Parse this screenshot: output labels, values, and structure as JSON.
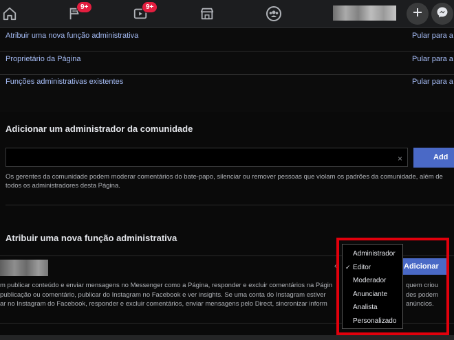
{
  "topbar": {
    "icons": [
      "home-icon",
      "flag-icon",
      "video-icon",
      "marketplace-icon",
      "groups-icon",
      "plus-icon",
      "messenger-icon"
    ],
    "badges": {
      "pages": "9+",
      "watch": "9+"
    }
  },
  "admin_links": [
    {
      "label": "Atribuir uma nova função administrativa",
      "skip": "Pular para a s"
    },
    {
      "label": "Proprietário da Página",
      "skip": "Pular para a s"
    },
    {
      "label": "Funções administrativas existentes",
      "skip": "Pular para a s"
    }
  ],
  "community": {
    "title": "Adicionar um administrador da comunidade",
    "input_value": "",
    "clear": "×",
    "add_label": "Add",
    "help_line1": "Os gerentes da comunidade podem moderar comentários do bate-papo, silenciar ou remover pessoas que violam os padrões da comunidade, além de",
    "help_line2": "todos os administradores desta Página."
  },
  "assign": {
    "title": "Atribuir uma nova função administrativa",
    "add_label": "Adicionar",
    "desc_lines": [
      "m publicar conteúdo e enviar mensagens no Messenger como a Página, responder e excluir comentários na Págin",
      "publicação ou comentário, publicar do Instagram no Facebook e ver insights. Se uma conta do Instagram estiver",
      "ar no Instagram do Facebook, responder e excluir comentários, enviar mensagens pelo Direct, sincronizar inform"
    ],
    "desc_right": [
      "quem criou",
      "des podem",
      "anúncios."
    ]
  },
  "role_dropdown": {
    "selected": "Editor",
    "check": "✓",
    "options": [
      "Administrador",
      "Editor",
      "Moderador",
      "Anunciante",
      "Analista",
      "Personalizado"
    ]
  },
  "colors": {
    "accent": "#4a69c6",
    "link": "#a7bef8",
    "highlight": "#e1000c",
    "badge": "#e41e3f"
  }
}
